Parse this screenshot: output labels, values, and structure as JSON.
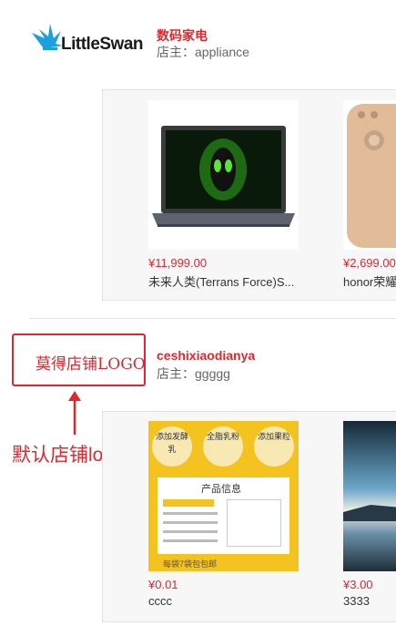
{
  "stores": [
    {
      "logo_text": "LittleSwan",
      "name": "数码家电",
      "owner": "店主：appliance",
      "products": [
        {
          "price": "¥11,999.00",
          "name": "未来人类(Terrans Force)S..."
        },
        {
          "price": "¥2,699.00",
          "name": "honor荣耀"
        }
      ]
    },
    {
      "logo_text": "莫得店铺LOGO",
      "name": "ceshixiaodianya",
      "owner": "店主：ggggg",
      "products": [
        {
          "price": "¥0.01",
          "name": "cccc"
        },
        {
          "price": "¥3.00",
          "name": "3333"
        }
      ]
    }
  ],
  "annotation": {
    "label": "默认店铺logo",
    "color": "#e4262c"
  },
  "milk_card": {
    "badges": [
      "添加发酵乳",
      "全脂乳粉",
      "添加果粒"
    ],
    "title": "产品信息",
    "footer": "每袋7袋包包邮"
  },
  "colors": {
    "accent": "#e4262c",
    "brand_blue": "#1aa0dc"
  }
}
